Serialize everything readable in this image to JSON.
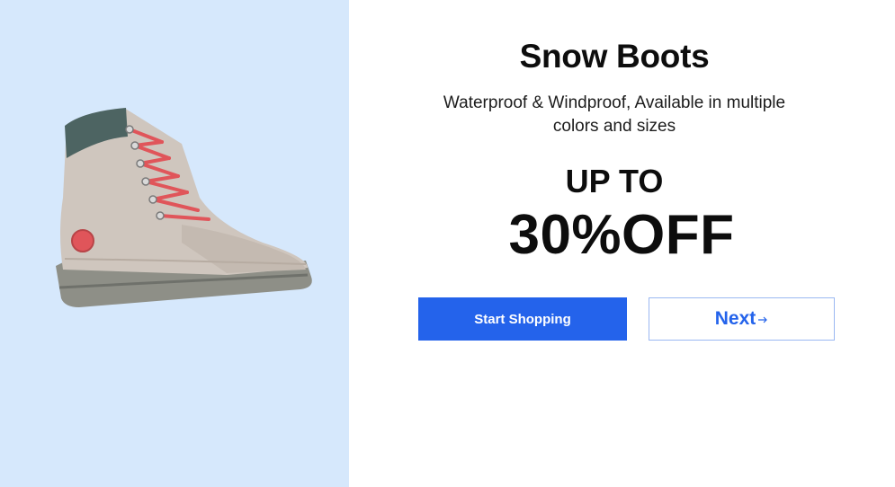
{
  "hero": {
    "image": {
      "alt": "Snow boot product image",
      "background_color": "#d6e8fc"
    },
    "title": "Snow Boots",
    "subtitle": "Waterproof & Windproof, Available in multiple colors and sizes",
    "promo_prefix": "UP TO",
    "promo_value": "30%OFF"
  },
  "actions": {
    "primary_label": "Start Shopping",
    "secondary_label": "Next",
    "secondary_icon": "arrow-right-icon",
    "primary_color": "#2463eb",
    "secondary_border_color": "#9bb8f2"
  }
}
